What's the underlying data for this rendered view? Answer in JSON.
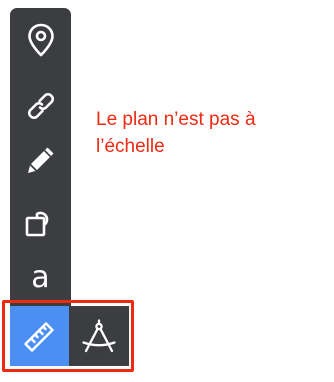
{
  "toolbar": {
    "tools": [
      {
        "icon": "map-pin-icon"
      },
      {
        "icon": "link-icon"
      },
      {
        "icon": "pencil-icon"
      },
      {
        "icon": "shapes-icon"
      },
      {
        "icon": "text-icon",
        "glyph": "a"
      }
    ],
    "measure": {
      "ruler_icon": "ruler-icon",
      "compass_icon": "compass-icon",
      "selected": "ruler"
    }
  },
  "note": {
    "text": "Le plan n’est pas à l’échelle"
  },
  "colors": {
    "toolbar_bg": "#3b3d41",
    "selected_bg": "#4c8ff2",
    "highlight": "#ee2a12",
    "note_text": "#ee2a12"
  }
}
